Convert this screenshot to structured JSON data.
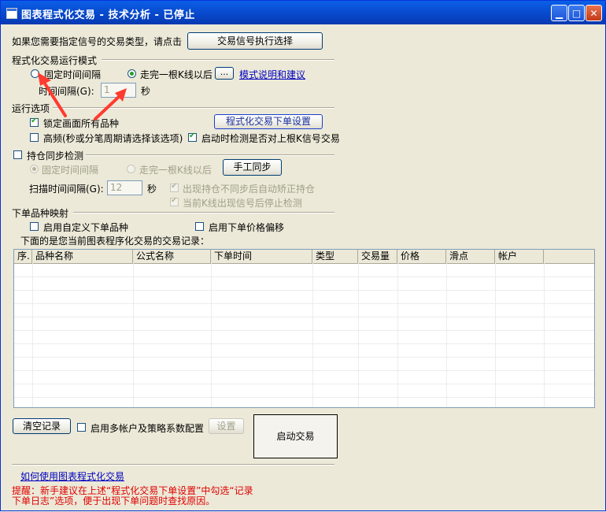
{
  "window": {
    "title": "图表程式化交易 - 技术分析 - 已停止",
    "min_glyph": "▁",
    "max_glyph": "□",
    "close_glyph": "✕"
  },
  "signal": {
    "prompt": "如果您需要指定信号的交易类型，请点击",
    "button": "交易信号执行选择"
  },
  "mode": {
    "heading": "程式化交易运行模式",
    "radio_fixed": "固定时间间隔",
    "radio_bar": "走完一根K线以后",
    "ellipsis_button": "...",
    "help_link": "模式说明和建议",
    "interval_label": "时间间隔(G):",
    "interval_value": "1",
    "unit": "秒"
  },
  "options": {
    "heading": "运行选项",
    "lock_all": "锁定画面所有品种",
    "order_settings_button": "程式化交易下单设置",
    "high_freq": "高频(秒或分笔周期请选择该选项)",
    "check_signal": "启动时检测是否对上根K信号交易"
  },
  "sync": {
    "heading": "持仓同步检测",
    "radio_fixed": "固定时间间隔",
    "radio_bar": "走完一根K线以后",
    "manual_button": "手工同步",
    "scan_label": "扫描时间间隔(G):",
    "scan_value": "12",
    "unit": "秒",
    "auto_fix": "出现持仓不同步后自动矫正持仓",
    "stop_check": "当前K线出现信号后停止检测"
  },
  "mapping": {
    "heading": "下单品种映射",
    "custom_symbol": "启用自定义下单品种",
    "price_offset": "启用下单价格偏移",
    "records_caption": "下面的是您当前图表程序化交易的交易记录："
  },
  "table": {
    "columns": [
      "序.",
      "品种名称",
      "公式名称",
      "下单时间",
      "类型",
      "交易量",
      "价格",
      "滑点",
      "帐户"
    ],
    "rows": []
  },
  "footer": {
    "clear_button": "清空记录",
    "multi_account": "启用多帐户及策略系数配置",
    "settings_button": "设置",
    "start_button": "启动交易",
    "howto_link": "如何使用图表程式化交易",
    "tip_line1": "提醒：新手建议在上述“程式化交易下单设置”中勾选“记录",
    "tip_line2": "下单日志”选项，便于出现下单问题时查找原因。"
  },
  "colors": {
    "title_bar": "#0847c9",
    "window_bg": "#ece9d8",
    "link": "#0000c0",
    "warning": "#e00000",
    "annotation_arrow": "#ff3b30"
  },
  "state": {
    "mode_selected": "bar",
    "lock_all": true,
    "high_freq": false,
    "check_signal": true,
    "sync_enabled": false,
    "sync_mode_selected": "fixed",
    "auto_fix": true,
    "stop_check": true,
    "custom_symbol": false,
    "price_offset": false,
    "multi_account": false
  }
}
